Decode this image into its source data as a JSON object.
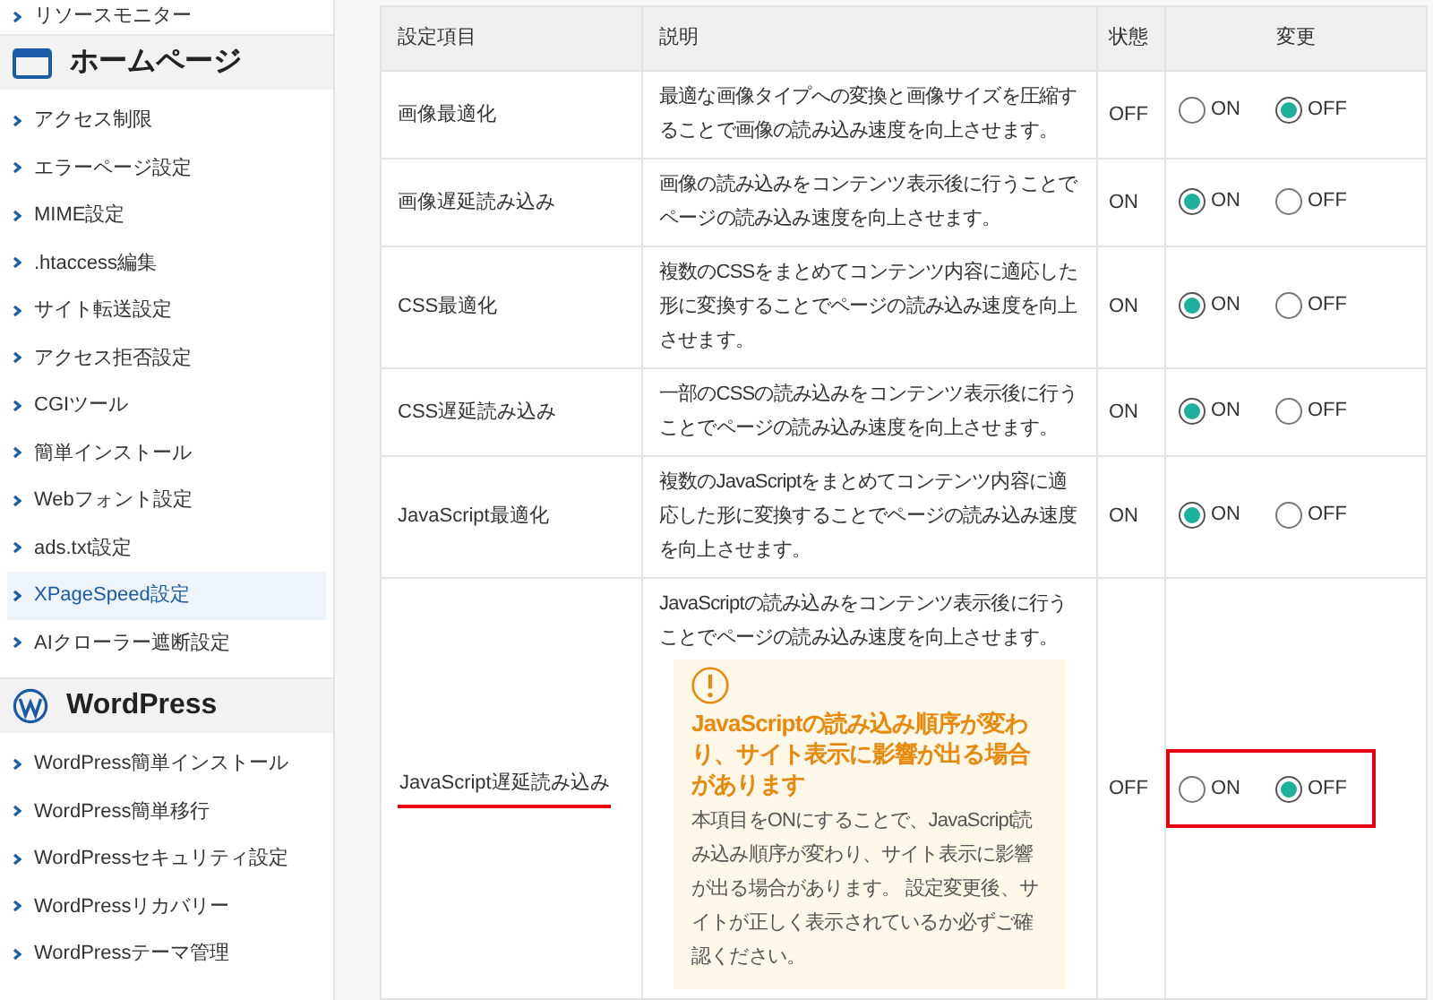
{
  "sidebar": {
    "top_item": {
      "label": "リソースモニター",
      "selected": false
    },
    "sections": [
      {
        "kind": "window",
        "title": "ホームページ",
        "items": [
          {
            "label": "アクセス制限",
            "selected": false
          },
          {
            "label": "エラーページ設定",
            "selected": false
          },
          {
            "label": "MIME設定",
            "selected": false
          },
          {
            "label": ".htaccess編集",
            "selected": false
          },
          {
            "label": "サイト転送設定",
            "selected": false
          },
          {
            "label": "アクセス拒否設定",
            "selected": false
          },
          {
            "label": "CGIツール",
            "selected": false
          },
          {
            "label": "簡単インストール",
            "selected": false
          },
          {
            "label": "Webフォント設定",
            "selected": false
          },
          {
            "label": "ads.txt設定",
            "selected": false
          },
          {
            "label": "XPageSpeed設定",
            "selected": true
          },
          {
            "label": "AIクローラー遮断設定",
            "selected": false
          }
        ]
      },
      {
        "kind": "wordpress",
        "title": "WordPress",
        "items": [
          {
            "label": "WordPress簡単インストール",
            "selected": false
          },
          {
            "label": "WordPress簡単移行",
            "selected": false
          },
          {
            "label": "WordPressセキュリティ設定",
            "selected": false
          },
          {
            "label": "WordPressリカバリー",
            "selected": false
          },
          {
            "label": "WordPressテーマ管理",
            "selected": false
          }
        ]
      }
    ]
  },
  "table": {
    "columns": [
      "設定項目",
      "説明",
      "状態",
      "変更"
    ],
    "rows": [
      {
        "name": "画像最適化",
        "description": "最適な画像タイプへの変換と画像サイズを圧縮することで画像の読み込み速度を向上させます。",
        "status": "OFF",
        "highlighted": false,
        "options": [
          {
            "label": "ON",
            "selected": false
          },
          {
            "label": "OFF",
            "selected": true
          }
        ]
      },
      {
        "name": "画像遅延読み込み",
        "description": "画像の読み込みをコンテンツ表示後に行うことでページの読み込み速度を向上させます。",
        "status": "ON",
        "highlighted": false,
        "options": [
          {
            "label": "ON",
            "selected": true
          },
          {
            "label": "OFF",
            "selected": false
          }
        ]
      },
      {
        "name": "CSS最適化",
        "description": "複数のCSSをまとめてコンテンツ内容に適応した形に変換することでページの読み込み速度を向上させます。",
        "status": "ON",
        "highlighted": false,
        "options": [
          {
            "label": "ON",
            "selected": true
          },
          {
            "label": "OFF",
            "selected": false
          }
        ]
      },
      {
        "name": "CSS遅延読み込み",
        "description": "一部のCSSの読み込みをコンテンツ表示後に行うことでページの読み込み速度を向上させます。",
        "status": "ON",
        "highlighted": false,
        "options": [
          {
            "label": "ON",
            "selected": true
          },
          {
            "label": "OFF",
            "selected": false
          }
        ]
      },
      {
        "name": "JavaScript最適化",
        "description": "複数のJavaScriptをまとめてコンテンツ内容に適応した形に変換することでページの読み込み速度を向上させます。",
        "status": "ON",
        "highlighted": false,
        "options": [
          {
            "label": "ON",
            "selected": true
          },
          {
            "label": "OFF",
            "selected": false
          }
        ]
      },
      {
        "name": "JavaScript遅延読み込み",
        "description": "JavaScriptの読み込みをコンテンツ表示後に行うことでページの読み込み速度を向上させます。",
        "status": "OFF",
        "highlighted": true,
        "warning": {
          "title": "JavaScriptの読み込み順序が変わり、サイト表示に影響が出る場合があります",
          "text": "本項目をONにすることで、JavaScript読み込み順序が変わり、サイト表示に影響が出る場合があります。 設定変更後、サイトが正しく表示されているか必ずご確認ください。"
        },
        "options": [
          {
            "label": "ON",
            "selected": false
          },
          {
            "label": "OFF",
            "selected": true
          }
        ]
      }
    ]
  }
}
